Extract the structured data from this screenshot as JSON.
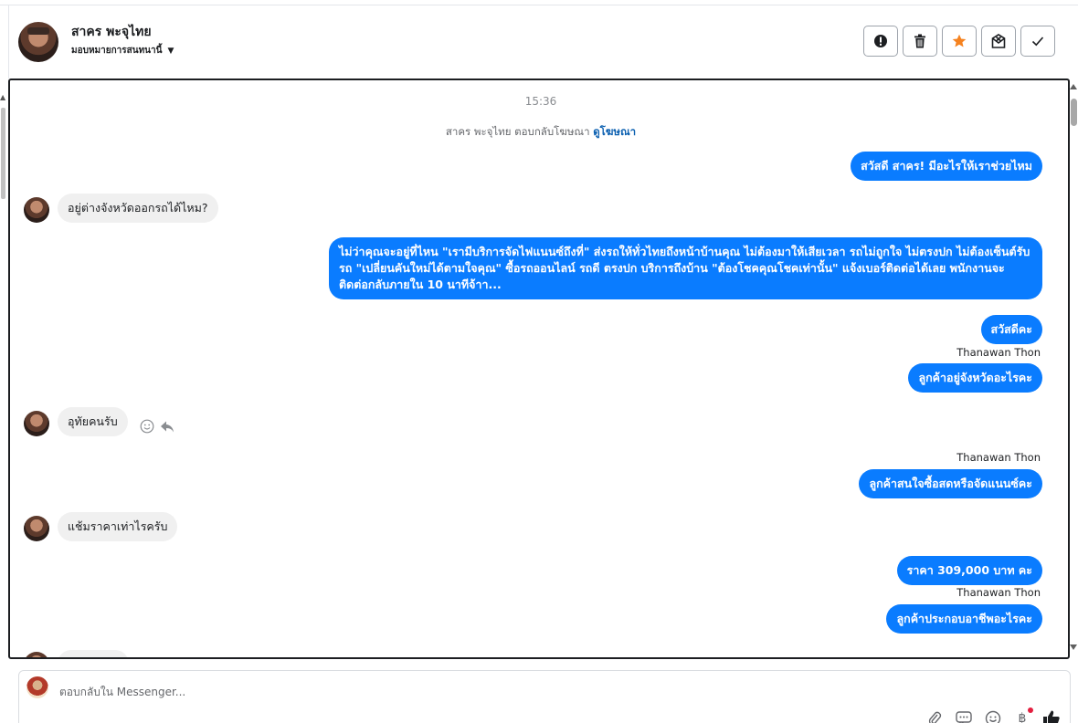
{
  "header": {
    "contact_name": "สาคร พะจุไทย",
    "assign_label": "มอบหมายการสนทนานี้",
    "actions": [
      {
        "name": "report",
        "icon": "alert-circle-icon"
      },
      {
        "name": "delete",
        "icon": "trash-icon"
      },
      {
        "name": "star",
        "icon": "star-icon",
        "color": "#f5821f"
      },
      {
        "name": "mark-unread",
        "icon": "envelope-x-icon"
      },
      {
        "name": "done",
        "icon": "checkmark-icon"
      }
    ]
  },
  "conversation": {
    "timestamp": "15:36",
    "ad_reply": {
      "text": "สาคร พะจุไทย ตอบกลับโฆษณา",
      "link": "ดูโฆษณา"
    },
    "messages": [
      {
        "direction": "out",
        "text": "สวัสดี สาคร! มีอะไรให้เราช่วยไหม"
      },
      {
        "direction": "in",
        "text": "อยู่ต่างจังหวัดออกรถได้ไหม?"
      },
      {
        "direction": "out",
        "text": "ไม่ว่าคุณจะอยู่ที่ไหน \"เรามีบริการจัดไฟแนนซ์ถึงที่\"  ส่งรถให้ทั่วไทยถึงหน้าบ้านคุณ ไม่ต้องมาให้เสียเวลา รถไม่ถูกใจ ไม่ตรงปก ไม่ต้องเซ็นต์รับรถ \"เปลี่ยนคันใหม่ได้ตามใจคุณ\" ซื้อรถออนไลน์ รถดี ตรงปก บริการถึงบ้าน \"ต้องโชคคุณโชคเท่านั้น\" แจ้งเบอร์ติดต่อได้เลย พนักงานจะติดต่อกลับภายใน 10 นาทีจ้าา..."
      },
      {
        "direction": "out",
        "text": "สวัสดีคะ"
      },
      {
        "direction": "out",
        "sender": "Thanawan Thon",
        "text": "ลูกค้าอยู่จังหวัดอะไรคะ"
      },
      {
        "direction": "in",
        "text": "อุทัยคนรับ"
      },
      {
        "direction": "out",
        "sender": "Thanawan Thon",
        "text": "ลูกค้าสนใจซื้อสดหรือจัดแนนซ์คะ"
      },
      {
        "direction": "in",
        "text": "แช้มราคาเท่าไรครับ"
      },
      {
        "direction": "out",
        "text": "ราคา 309,000 บาท คะ"
      },
      {
        "direction": "out",
        "sender": "Thanawan Thon",
        "text": "ลูกค้าประกอบอาชีพอะไรคะ"
      }
    ],
    "reply_icons": [
      "smiley-icon",
      "reply-arrow-icon"
    ]
  },
  "composer": {
    "placeholder": "ตอบกลับใน Messenger...",
    "tools": [
      "paperclip-icon",
      "saved-reply-icon",
      "emoji-icon",
      "baht-icon",
      "thumbs-up-icon"
    ]
  },
  "colors": {
    "outgoing_bubble": "#0a7cff",
    "incoming_bubble": "#f0f0f0",
    "star": "#f5821f",
    "link": "#0a5fb0"
  }
}
